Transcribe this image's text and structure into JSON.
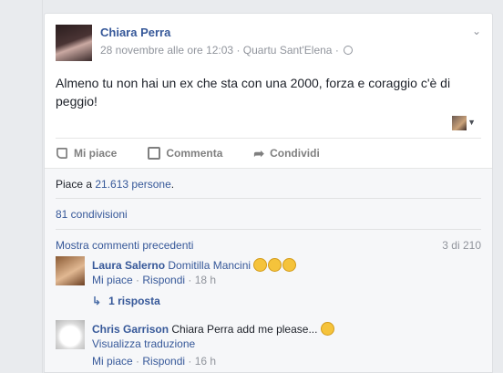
{
  "post": {
    "author": "Chiara Perra",
    "date": "28 novembre alle ore 12:03",
    "location": "Quartu Sant'Elena",
    "separator": "·",
    "text": "Almeno tu non hai un ex che sta con una 2000, forza e coraggio c'è di peggio!",
    "options_icon": "chevron-down-icon",
    "privacy_icon": "globe-icon"
  },
  "actions": {
    "like_label": "Mi piace",
    "comment_label": "Commenta",
    "share_label": "Condividi"
  },
  "ufi": {
    "likes_prefix": "Piace a ",
    "likes_count": "21.613 persone",
    "likes_suffix": ".",
    "shares": "81 condivisioni",
    "more_comments": "Mostra commenti precedenti",
    "comment_count": "3 di 210"
  },
  "comments": [
    {
      "author": "Laura Salerno",
      "mention": "Domitilla Mancini",
      "emoji_count": 3,
      "like_label": "Mi piace",
      "reply_label": "Rispondi",
      "time": "18 h",
      "replies": "1 risposta"
    },
    {
      "author": "Chris Garrison",
      "text": "Chiara Perra add me please...",
      "translate": "Visualizza traduzione",
      "like_label": "Mi piace",
      "reply_label": "Rispondi",
      "time": "16 h"
    }
  ]
}
